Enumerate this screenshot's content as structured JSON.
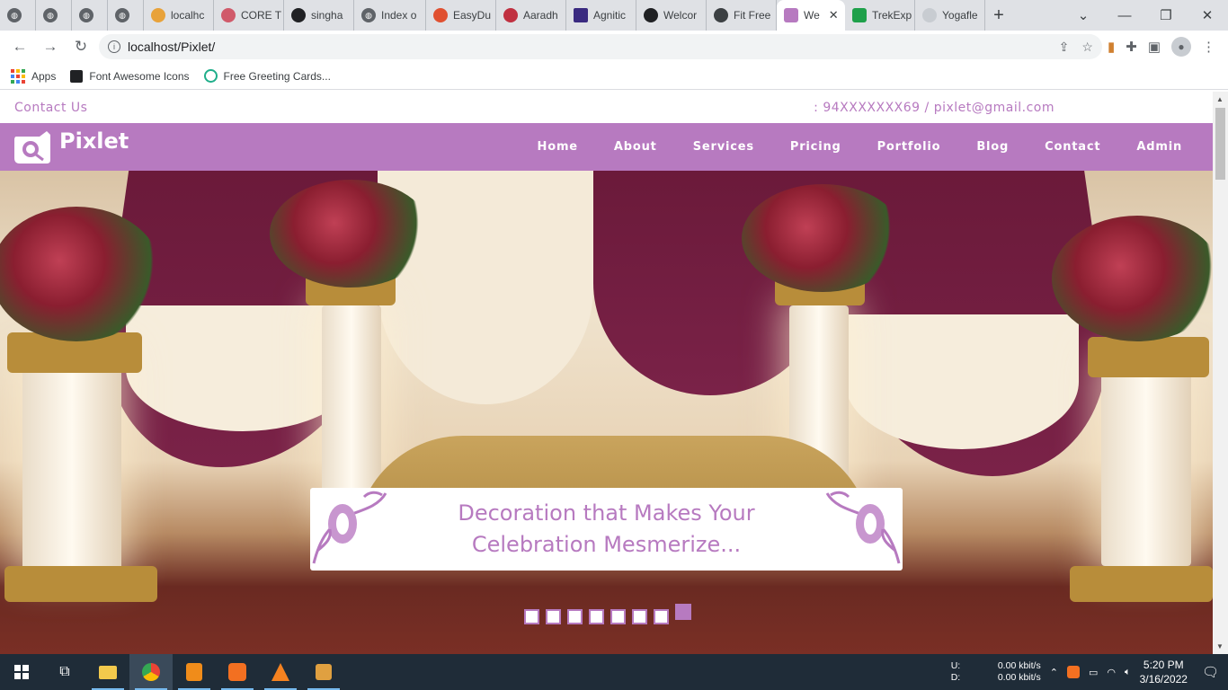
{
  "browser": {
    "tabs": [
      {
        "label": "",
        "icon": "globe-icon"
      },
      {
        "label": "",
        "icon": "globe-icon"
      },
      {
        "label": "",
        "icon": "globe-icon"
      },
      {
        "label": "",
        "icon": "globe-icon"
      },
      {
        "label": "localhc",
        "icon": "phpmyadmin-icon"
      },
      {
        "label": "CORE T",
        "icon": "core-icon"
      },
      {
        "label": "singha",
        "icon": "github-icon"
      },
      {
        "label": "Index o",
        "icon": "globe-icon"
      },
      {
        "label": "EasyDu",
        "icon": "easydu-icon"
      },
      {
        "label": "Aaradh",
        "icon": "aaradh-icon"
      },
      {
        "label": "Agnitic",
        "icon": "agnitio-icon"
      },
      {
        "label": "Welcor",
        "icon": "arch-icon"
      },
      {
        "label": "Fit Free",
        "icon": "shield-icon"
      },
      {
        "label": "We",
        "icon": "pixlet-icon",
        "active": true
      },
      {
        "label": "TrekExp",
        "icon": "trek-icon"
      },
      {
        "label": "Yogafle",
        "icon": "yoga-icon"
      }
    ],
    "url": "localhost/Pixlet/",
    "bookmarks": [
      "Apps",
      "Font Awesome Icons",
      "Free Greeting Cards..."
    ]
  },
  "site": {
    "topbar": {
      "contact_label": "Contact Us",
      "contact_info": ": 94XXXXXXX69 / pixlet@gmail.com"
    },
    "brand": "Pixlet",
    "menu": [
      "Home",
      "About",
      "Services",
      "Pricing",
      "Portfolio",
      "Blog",
      "Contact",
      "Admin"
    ],
    "hero": {
      "caption_line1": "Decoration that Makes Your",
      "caption_line2": "Celebration Mesmerize...",
      "slide_count": 8,
      "active_slide": 8
    },
    "accent_color": "#b77ac0"
  },
  "taskbar": {
    "net_up_label": "U:",
    "net_up_value": "0.00 kbit/s",
    "net_down_label": "D:",
    "net_down_value": "0.00 kbit/s",
    "time": "5:20 PM",
    "date": "3/16/2022"
  }
}
